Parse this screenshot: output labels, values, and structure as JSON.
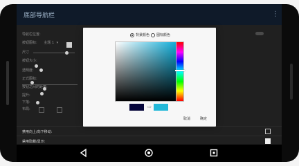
{
  "app_bar": {
    "title": "底部导航栏",
    "overflow_icon": "more-vertical-icon"
  },
  "settings": {
    "items": [
      {
        "label": "导航栏位置:"
      },
      {
        "label": "按钮图标:",
        "value": "主题 1"
      },
      {
        "label": "尺寸"
      },
      {
        "label": "按钮大小:"
      },
      {
        "label": "透明度:"
      },
      {
        "label": "正式图标:"
      },
      {
        "label": "按钮之间的距离:"
      },
      {
        "label": "提升:"
      },
      {
        "label": "下落:"
      },
      {
        "label": "布局:"
      }
    ]
  },
  "bottom_rows": [
    {
      "label": "禁用向上/向下移动:",
      "checked": false
    },
    {
      "label": "禁用隐藏/显示:",
      "checked": true
    }
  ],
  "dialog": {
    "radios": [
      {
        "label": "背景颜色",
        "selected": true
      },
      {
        "label": "图标颜色",
        "selected": false
      }
    ],
    "saturation": 1.0,
    "brightness": 0.9,
    "hue_position": 0.48,
    "old_color": "#05053a",
    "new_color": "#22b8d8",
    "arrow_icon": "arrow-right-icon",
    "cancel_label": "取消",
    "ok_label": "确定"
  },
  "nav_bar": {
    "back_icon": "back-triangle-icon",
    "home_icon": "home-circle-icon",
    "recents_icon": "recents-square-icon"
  }
}
